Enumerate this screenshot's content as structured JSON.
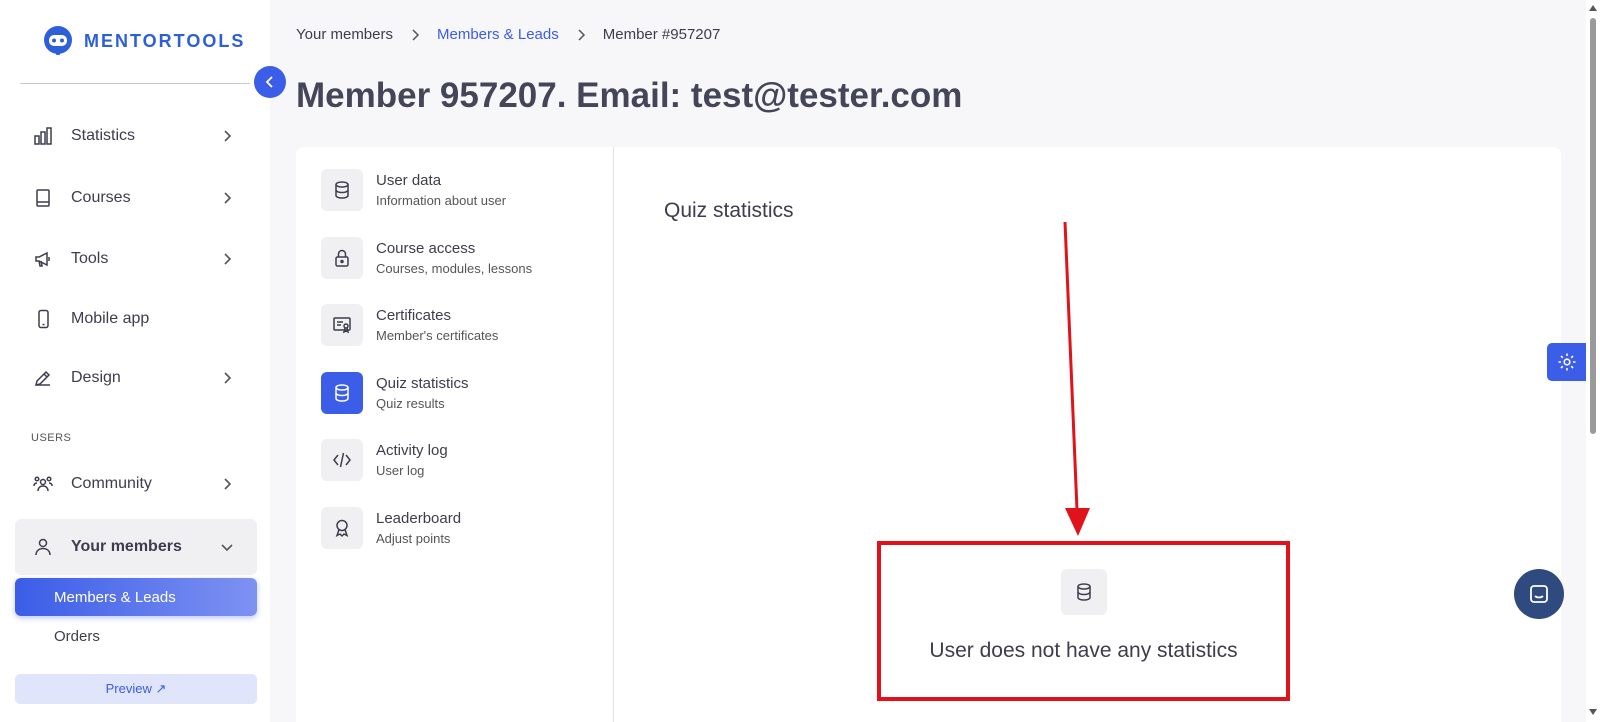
{
  "brand": {
    "name": "MENTORTOOLS",
    "color": "#2d5fd8"
  },
  "accent_color": "#3b5de7",
  "sidebar": {
    "items": [
      {
        "label": "Statistics",
        "icon": "bar-chart-icon"
      },
      {
        "label": "Courses",
        "icon": "book-icon"
      },
      {
        "label": "Tools",
        "icon": "megaphone-icon"
      },
      {
        "label": "Mobile app",
        "icon": "phone-icon"
      },
      {
        "label": "Design",
        "icon": "pencil-icon"
      }
    ],
    "section_users": "USERS",
    "community": {
      "label": "Community",
      "icon": "users-icon"
    },
    "your_members": {
      "label": "Your members",
      "icon": "user-icon"
    },
    "sub_items": [
      {
        "label": "Members & Leads",
        "active": true
      },
      {
        "label": "Orders",
        "active": false
      }
    ],
    "preview_label": "Preview ↗"
  },
  "breadcrumb": [
    "Your members",
    "Members & Leads",
    "Member #957207"
  ],
  "page_title": "Member 957207. Email: test@tester.com",
  "member_menu": [
    {
      "title": "User data",
      "subtitle": "Information about user",
      "icon": "database-icon"
    },
    {
      "title": "Course access",
      "subtitle": "Courses, modules, lessons",
      "icon": "lock-icon"
    },
    {
      "title": "Certificates",
      "subtitle": "Member's certificates",
      "icon": "certificate-icon"
    },
    {
      "title": "Quiz statistics",
      "subtitle": "Quiz results",
      "icon": "database-icon",
      "active": true
    },
    {
      "title": "Activity log",
      "subtitle": "User log",
      "icon": "code-icon"
    },
    {
      "title": "Leaderboard",
      "subtitle": "Adjust points",
      "icon": "award-icon"
    }
  ],
  "content": {
    "title": "Quiz statistics",
    "empty_message": "User does not have any statistics"
  },
  "annotation_color": "#e1131a"
}
